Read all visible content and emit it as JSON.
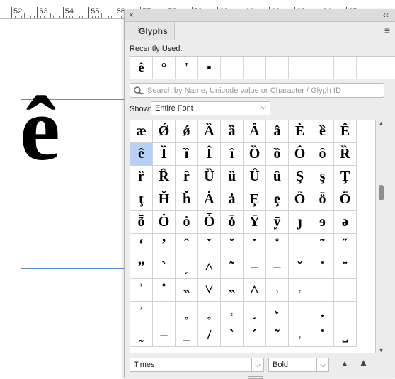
{
  "ruler": {
    "numbers": [
      "52",
      "53",
      "54",
      "55",
      "56",
      "57",
      "58",
      "59",
      "60",
      "61",
      "62",
      "63",
      "64",
      "65"
    ]
  },
  "document": {
    "glyph": "ê"
  },
  "panel": {
    "tab_label": "Glyphs",
    "close_glyph": "×",
    "collapse_glyph": "‹‹",
    "menu_glyph": "≡",
    "recently_used_label": "Recently Used:",
    "recent_glyphs": [
      "ê",
      "°",
      "'",
      "▪",
      "",
      "",
      "",
      "",
      "",
      "",
      "",
      ""
    ],
    "search": {
      "placeholder": "Search by Name, Unicode value or Character / Glyph ID",
      "value": ""
    },
    "show_label": "Show:",
    "show_value": "Entire Font",
    "selected_glyph": "ê",
    "glyph_rows": [
      [
        "æ",
        "Ǿ",
        "ǿ",
        "Ȁ",
        "ȁ",
        "Â",
        "â",
        "È",
        "ȅ",
        "Ê"
      ],
      [
        "ê",
        "Ȉ",
        "ȉ",
        "Î",
        "î",
        "Ȍ",
        "ȍ",
        "Ô",
        "ô",
        "Ȑ"
      ],
      [
        "ȑ",
        "Ȓ",
        "ȓ",
        "Ȕ",
        "ȕ",
        "Û",
        "û",
        "Ş",
        "ş",
        "Ţ"
      ],
      [
        "ţ",
        "Ȟ",
        "ȟ",
        "Ȧ",
        "ȧ",
        "Ȩ",
        "ȩ",
        "Ȫ",
        "ȫ",
        "Ȭ"
      ],
      [
        "ȭ",
        "Ȯ",
        "ȯ",
        "Ȱ",
        "ȱ",
        "Ȳ",
        "ȳ",
        "ȷ",
        "ɘ",
        "ə"
      ],
      [
        "ʻ",
        "ʼ",
        "ˆ",
        "ˇ",
        "˘",
        "˙",
        "˚",
        "",
        "˜",
        "˝"
      ],
      [
        "ˮ",
        "ˋ",
        "ˏ",
        "˄",
        "˜",
        "–",
        "‒",
        "˘",
        "˙",
        "¨"
      ],
      [
        "ʾ",
        "˚",
        "˵",
        "˅",
        "˵",
        "˄",
        "˒",
        "˓",
        "",
        ""
      ],
      [
        "ʾ",
        "",
        "˳",
        "˳",
        "˓",
        "ˏ",
        "˞",
        "",
        ".",
        ""
      ],
      [
        "˷",
        "–",
        "_",
        "/",
        "`",
        "´",
        "˜",
        "˒",
        "˙",
        "˽"
      ]
    ],
    "font_family": "Times",
    "font_style": "Bold",
    "zoom_out_glyph": "▲",
    "zoom_in_glyph": "▲",
    "scroll_up_glyph": "▲",
    "scroll_down_glyph": "▼",
    "dropdown_glyph": "⌵"
  }
}
